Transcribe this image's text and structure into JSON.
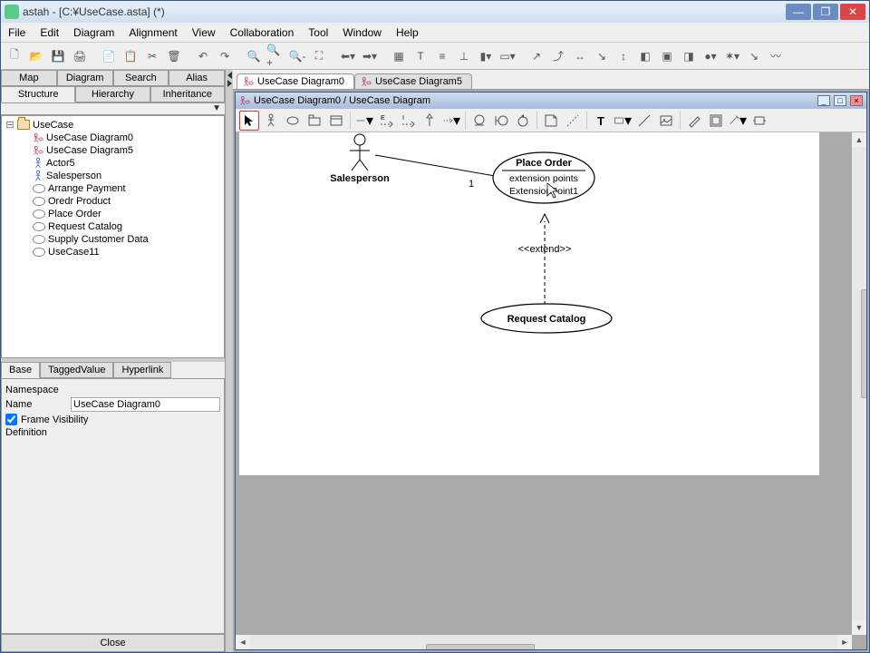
{
  "window": {
    "title": "astah - [C:¥UseCase.asta] (*)"
  },
  "menubar": [
    "File",
    "Edit",
    "Diagram",
    "Alignment",
    "View",
    "Collaboration",
    "Tool",
    "Window",
    "Help"
  ],
  "left": {
    "tabs_top": [
      "Map",
      "Diagram",
      "Search",
      "Alias"
    ],
    "tabs_bottom": [
      "Structure",
      "Hierarchy",
      "Inheritance"
    ],
    "active_top": "Diagram",
    "active_bottom": "Structure",
    "tree": {
      "root": "UseCase",
      "children": [
        {
          "type": "diagram",
          "label": "UseCase Diagram0"
        },
        {
          "type": "diagram",
          "label": "UseCase Diagram5"
        },
        {
          "type": "actor",
          "label": "Actor5"
        },
        {
          "type": "actor",
          "label": "Salesperson"
        },
        {
          "type": "usecase",
          "label": "Arrange Payment"
        },
        {
          "type": "usecase",
          "label": "Oredr Product"
        },
        {
          "type": "usecase",
          "label": "Place Order"
        },
        {
          "type": "usecase",
          "label": "Request Catalog"
        },
        {
          "type": "usecase",
          "label": "Supply Customer Data"
        },
        {
          "type": "usecase",
          "label": "UseCase11"
        }
      ]
    }
  },
  "prop": {
    "tabs": [
      "Base",
      "TaggedValue",
      "Hyperlink"
    ],
    "active": "Base",
    "namespace_label": "Namespace",
    "name_label": "Name",
    "name_value": "UseCase Diagram0",
    "frame_vis_label": "Frame Visibility",
    "frame_vis_checked": true,
    "definition_label": "Definition",
    "close": "Close"
  },
  "doc_tabs": [
    {
      "label": "UseCase Diagram0",
      "active": true
    },
    {
      "label": "UseCase Diagram5",
      "active": false
    }
  ],
  "diagram_window_title": "UseCase Diagram0 / UseCase Diagram",
  "diagram": {
    "actor_label": "Salesperson",
    "assoc_mult": "1",
    "usecase1_title": "Place Order",
    "usecase1_ext_header": "extension points",
    "usecase1_ext1": "ExtensionPoint1",
    "extend_label": "<<extend>>",
    "usecase2_title": "Request Catalog"
  }
}
